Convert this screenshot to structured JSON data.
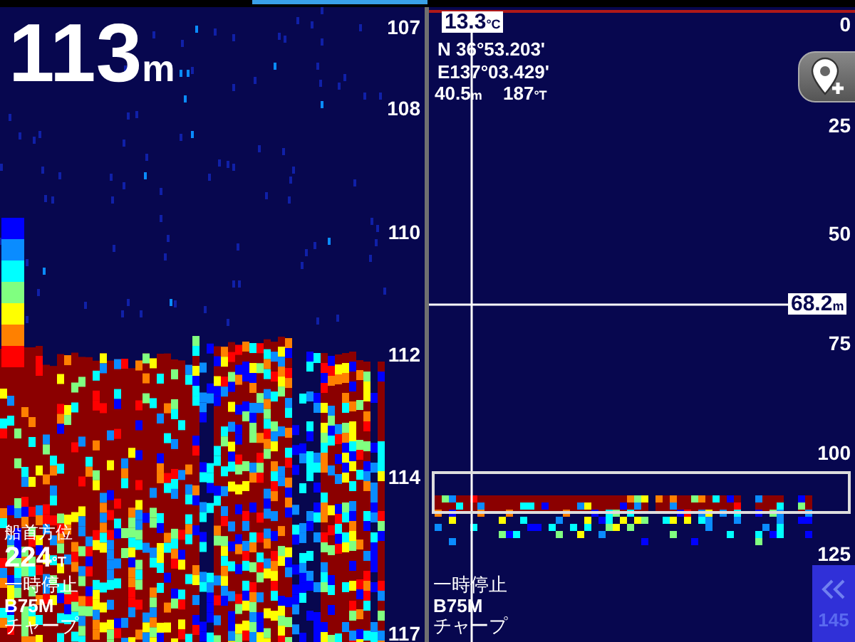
{
  "left_pane": {
    "depth": {
      "value": "113",
      "unit": "m"
    },
    "scale": [
      "107",
      "108",
      "110",
      "112",
      "114",
      "117"
    ],
    "color_scale": [
      {
        "color": "#0000ff"
      },
      {
        "color": "#0a8cff"
      },
      {
        "color": "#00ffff"
      },
      {
        "color": "#80ff80"
      },
      {
        "color": "#ffff00"
      },
      {
        "color": "#ff8000"
      },
      {
        "color": "#ff0000"
      },
      {
        "color": "#8b0000"
      }
    ],
    "heading": {
      "label": "船首方位",
      "value": "224",
      "unit": "°T"
    },
    "status": "一時停止",
    "frequency": "B75M",
    "mode": "チャープ"
  },
  "right_pane": {
    "temperature": {
      "value": "13.3",
      "unit": "°C"
    },
    "latitude": "N  36°53.203'",
    "longitude": "E137°03.429'",
    "depth_reading": {
      "value": "40.5",
      "unit": "m"
    },
    "heading": {
      "value": "187",
      "unit": "°T"
    },
    "scale": [
      "0",
      "25",
      "50",
      "75",
      "100",
      "125",
      "145"
    ],
    "range_marker": {
      "value": "68.2",
      "unit": "m"
    },
    "status": "一時停止",
    "frequency": "B75M",
    "mode": "チャープ"
  }
}
